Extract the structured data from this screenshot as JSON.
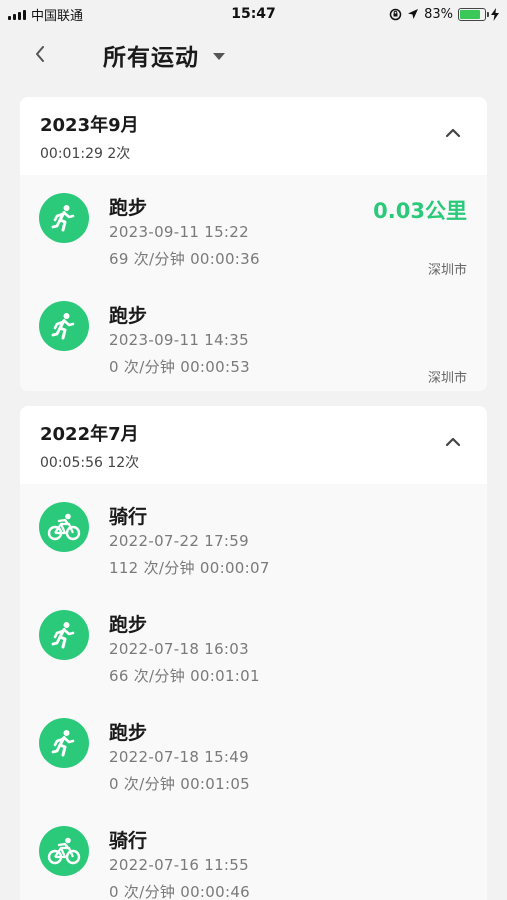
{
  "status_bar": {
    "carrier": "中国联通",
    "time": "15:47",
    "battery": "83%",
    "battery_level": 0.83
  },
  "header": {
    "title": "所有运动"
  },
  "groups": [
    {
      "month": "2023年9月",
      "summary": "00:01:29 2次",
      "items": [
        {
          "type": "跑步",
          "icon": "running-icon",
          "date": "2023-09-11 15:22",
          "stats": "69 次/分钟 00:00:36",
          "distance": "0.03公里",
          "city": "深圳市"
        },
        {
          "type": "跑步",
          "icon": "running-icon",
          "date": "2023-09-11 14:35",
          "stats": "0 次/分钟 00:00:53",
          "distance": "",
          "city": "深圳市"
        }
      ]
    },
    {
      "month": "2022年7月",
      "summary": "00:05:56 12次",
      "items": [
        {
          "type": "骑行",
          "icon": "cycling-icon",
          "date": "2022-07-22 17:59",
          "stats": "112 次/分钟 00:00:07",
          "distance": "",
          "city": ""
        },
        {
          "type": "跑步",
          "icon": "running-icon",
          "date": "2022-07-18 16:03",
          "stats": "66 次/分钟 00:01:01",
          "distance": "",
          "city": ""
        },
        {
          "type": "跑步",
          "icon": "running-icon",
          "date": "2022-07-18 15:49",
          "stats": "0 次/分钟 00:01:05",
          "distance": "",
          "city": ""
        },
        {
          "type": "骑行",
          "icon": "cycling-icon",
          "date": "2022-07-16 11:55",
          "stats": "0 次/分钟 00:00:46",
          "distance": "",
          "city": ""
        }
      ]
    }
  ],
  "colors": {
    "accent": "#2bc97a",
    "background": "#f2f2f2",
    "battery": "#3ac859"
  }
}
